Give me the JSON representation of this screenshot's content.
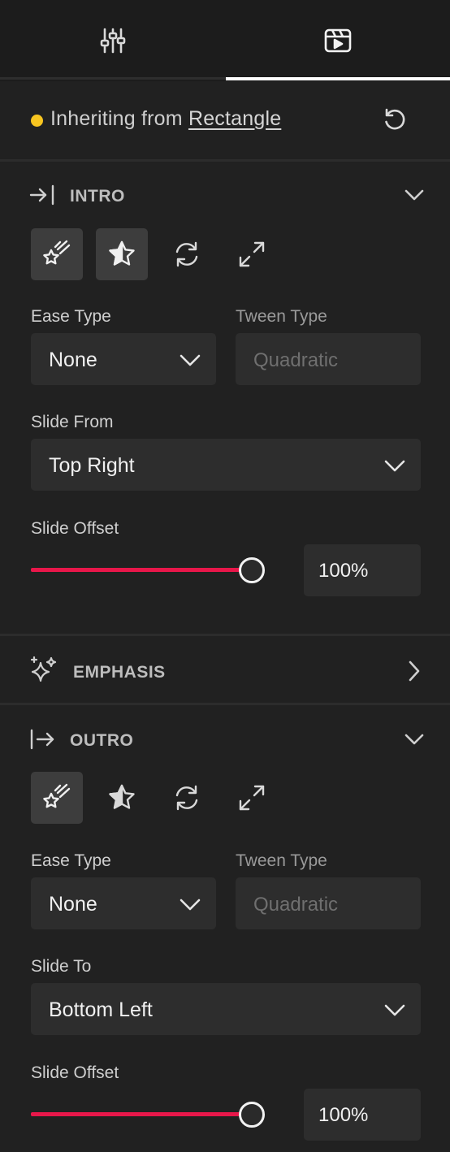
{
  "colors": {
    "accent_slider": "#e8174a",
    "inherit_dot": "#f7c520",
    "background": "#212121",
    "field": "#2d2d2d"
  },
  "tabs": [
    {
      "icon": "sliders-icon",
      "active": false
    },
    {
      "icon": "clapperboard-icon",
      "active": true
    }
  ],
  "inherit": {
    "prefix": "Inheriting from",
    "source": "Rectangle",
    "reset_icon": "reset-icon"
  },
  "intro": {
    "title": "INTRO",
    "expanded": true,
    "animation_types": [
      {
        "icon": "shooting-star-icon",
        "active": true
      },
      {
        "icon": "star-icon",
        "active": true
      },
      {
        "icon": "refresh-icon",
        "active": false
      },
      {
        "icon": "expand-icon",
        "active": false
      }
    ],
    "ease_type_label": "Ease Type",
    "ease_type_value": "None",
    "tween_type_label": "Tween Type",
    "tween_type_value": "Quadratic",
    "direction_label": "Slide From",
    "direction_value": "Top Right",
    "offset_label": "Slide Offset",
    "offset_value": "100%",
    "offset_fraction": 1.0
  },
  "emphasis": {
    "title": "EMPHASIS",
    "expanded": false
  },
  "outro": {
    "title": "OUTRO",
    "expanded": true,
    "animation_types": [
      {
        "icon": "shooting-star-icon",
        "active": true
      },
      {
        "icon": "star-icon",
        "active": false
      },
      {
        "icon": "refresh-icon",
        "active": false
      },
      {
        "icon": "expand-icon",
        "active": false
      }
    ],
    "ease_type_label": "Ease Type",
    "ease_type_value": "None",
    "tween_type_label": "Tween Type",
    "tween_type_value": "Quadratic",
    "direction_label": "Slide To",
    "direction_value": "Bottom Left",
    "offset_label": "Slide Offset",
    "offset_value": "100%",
    "offset_fraction": 1.0
  }
}
